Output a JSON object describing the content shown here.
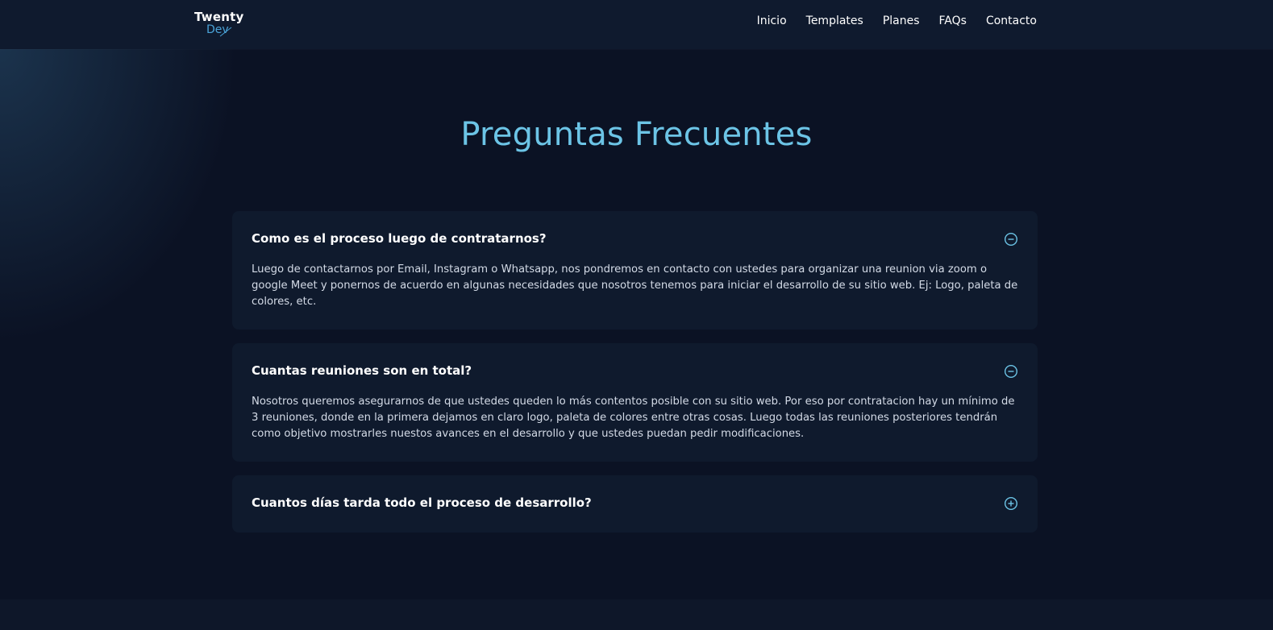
{
  "logo": {
    "line1": "Twenty",
    "line2": "Dev"
  },
  "nav": {
    "items": [
      "Inicio",
      "Templates",
      "Planes",
      "FAQs",
      "Contacto"
    ]
  },
  "page_title": "Preguntas Frecuentes",
  "faqs": [
    {
      "question": "Como es el proceso luego de contratarnos?",
      "answer": "Luego de contactarnos por Email, Instagram o Whatsapp, nos pondremos en contacto con ustedes para organizar una reunion via zoom o google Meet y ponernos de acuerdo en algunas necesidades que nosotros tenemos para iniciar el desarrollo de su sitio web. Ej: Logo, paleta de colores, etc.",
      "expanded": true,
      "icon": "minus-circle-icon"
    },
    {
      "question": "Cuantas reuniones son en total?",
      "answer": "Nosotros queremos asegurarnos de que ustedes queden lo más contentos posible con su sitio web. Por eso por contratacion hay un mínimo de 3 reuniones, donde en la primera dejamos en claro logo, paleta de colores entre otras cosas. Luego todas las reuniones posteriores tendrán como objetivo mostrarles nuestos avances en el desarrollo y que ustedes puedan pedir modificaciones.",
      "expanded": true,
      "icon": "minus-circle-icon"
    },
    {
      "question": "Cuantos días tarda todo el proceso de desarrollo?",
      "expanded": false,
      "icon": "plus-circle-icon"
    }
  ],
  "colors": {
    "accent": "#6cc4e6",
    "background": "#0b1224",
    "card": "#0f1a2d",
    "navbar": "#0f1a2e"
  }
}
